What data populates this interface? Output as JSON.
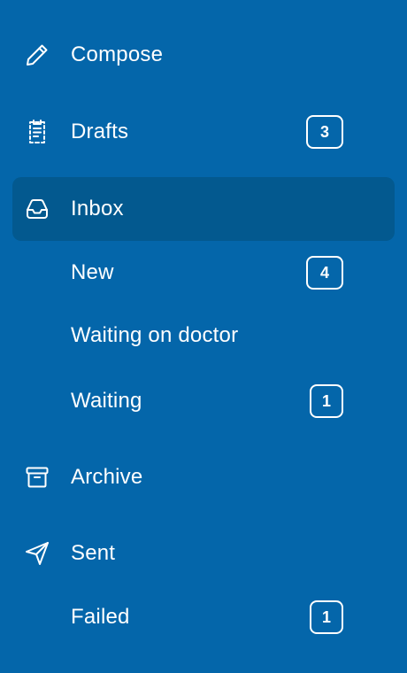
{
  "sidebar": {
    "compose": {
      "label": "Compose",
      "icon": "pencil-icon"
    },
    "drafts": {
      "label": "Drafts",
      "count": "3",
      "icon": "drafts-icon"
    },
    "inbox": {
      "label": "Inbox",
      "icon": "inbox-tray-icon",
      "children": {
        "new": {
          "label": "New",
          "count": "4"
        },
        "waiting_on_doctor": {
          "label": "Waiting on doctor"
        },
        "waiting": {
          "label": "Waiting",
          "count": "1"
        }
      }
    },
    "archive": {
      "label": "Archive",
      "icon": "archive-box-icon"
    },
    "sent": {
      "label": "Sent",
      "icon": "paper-plane-icon",
      "children": {
        "failed": {
          "label": "Failed",
          "count": "1"
        }
      }
    }
  },
  "colors": {
    "background": "#0466aa",
    "active_item": "#03598f",
    "text": "#ffffff"
  }
}
